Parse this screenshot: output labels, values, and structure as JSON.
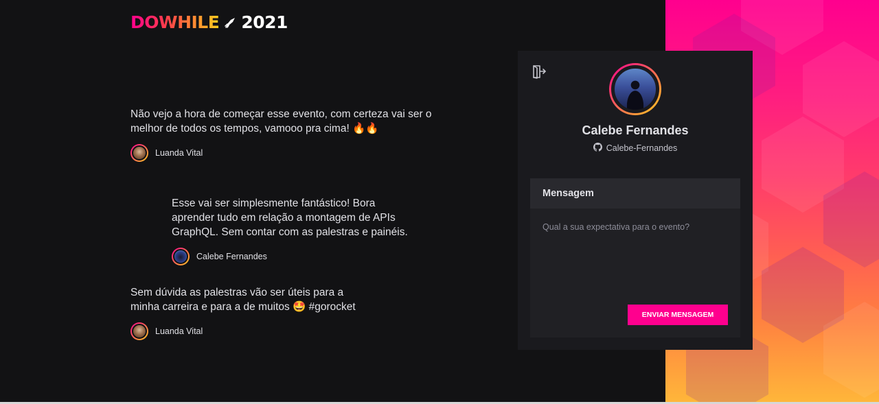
{
  "logo": {
    "brand": "DOWHILE",
    "year": "2021",
    "rocket_icon": "rocket-icon"
  },
  "messages": [
    {
      "text": "Não vejo a hora de começar esse evento, com certeza vai ser o melhor de todos os tempos, vamooo pra cima! 🔥🔥",
      "user": "Luanda Vital"
    },
    {
      "text": "Esse vai ser simplesmente fantástico! Bora aprender tudo em relação a montagem de APIs GraphQL. Sem contar com as palestras e painéis.",
      "user": "Calebe Fernandes"
    },
    {
      "text": "Sem dúvida as palestras vão ser úteis para a minha carreira e para a de muitos 🤩 #gorocket",
      "user": "Luanda Vital"
    }
  ],
  "profile": {
    "name": "Calebe Fernandes",
    "github": "Calebe-Fernandes",
    "github_icon": "github-icon",
    "signout_icon": "sign-out-icon"
  },
  "form": {
    "title": "Mensagem",
    "placeholder": "Qual a sua expectativa para o evento?",
    "value": "",
    "submit_label": "ENVIAR MENSAGEM"
  },
  "colors": {
    "background": "#121214",
    "card": "#1a1a1e",
    "accent": "#ff008e",
    "gradient_end": "#ffcd1e"
  }
}
